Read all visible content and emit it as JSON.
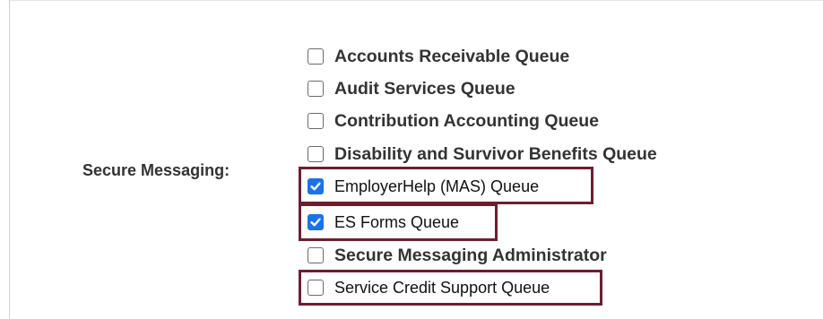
{
  "section": {
    "label": "Secure Messaging:"
  },
  "options": [
    {
      "label": "Accounts Receivable Queue",
      "checked": false
    },
    {
      "label": "Audit Services Queue",
      "checked": false
    },
    {
      "label": "Contribution Accounting Queue",
      "checked": false
    },
    {
      "label": "Disability and Survivor Benefits Queue",
      "checked": false
    },
    {
      "label": "EmployerHelp (MAS) Queue",
      "checked": true
    },
    {
      "label": "ES Forms Queue",
      "checked": true
    },
    {
      "label": "Secure Messaging Administrator",
      "checked": false
    },
    {
      "label": "Service Credit Support Queue",
      "checked": false
    }
  ],
  "colors": {
    "highlight": "#6b1f2e",
    "checkbox_checked": "#1a73e8"
  },
  "icons": {
    "checked": "checkmark-icon"
  }
}
